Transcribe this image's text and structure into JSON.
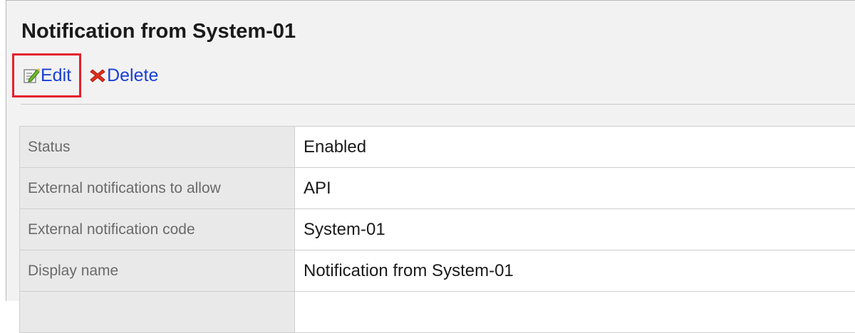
{
  "page": {
    "title": "Notification from System-01"
  },
  "toolbar": {
    "edit_label": "Edit",
    "delete_label": "Delete"
  },
  "details": {
    "rows": [
      {
        "label": "Status",
        "value": "Enabled"
      },
      {
        "label": "External notifications to allow",
        "value": "API"
      },
      {
        "label": "External notification code",
        "value": "System-01"
      },
      {
        "label": "Display name",
        "value": "Notification from System-01"
      }
    ]
  },
  "colors": {
    "link": "#1a3fd6",
    "status_enabled": "#22961e",
    "highlight_border": "#e5202e",
    "delete_icon": "#e0301e"
  },
  "icons": {
    "edit": "edit-pencil-icon",
    "delete": "delete-x-icon"
  }
}
